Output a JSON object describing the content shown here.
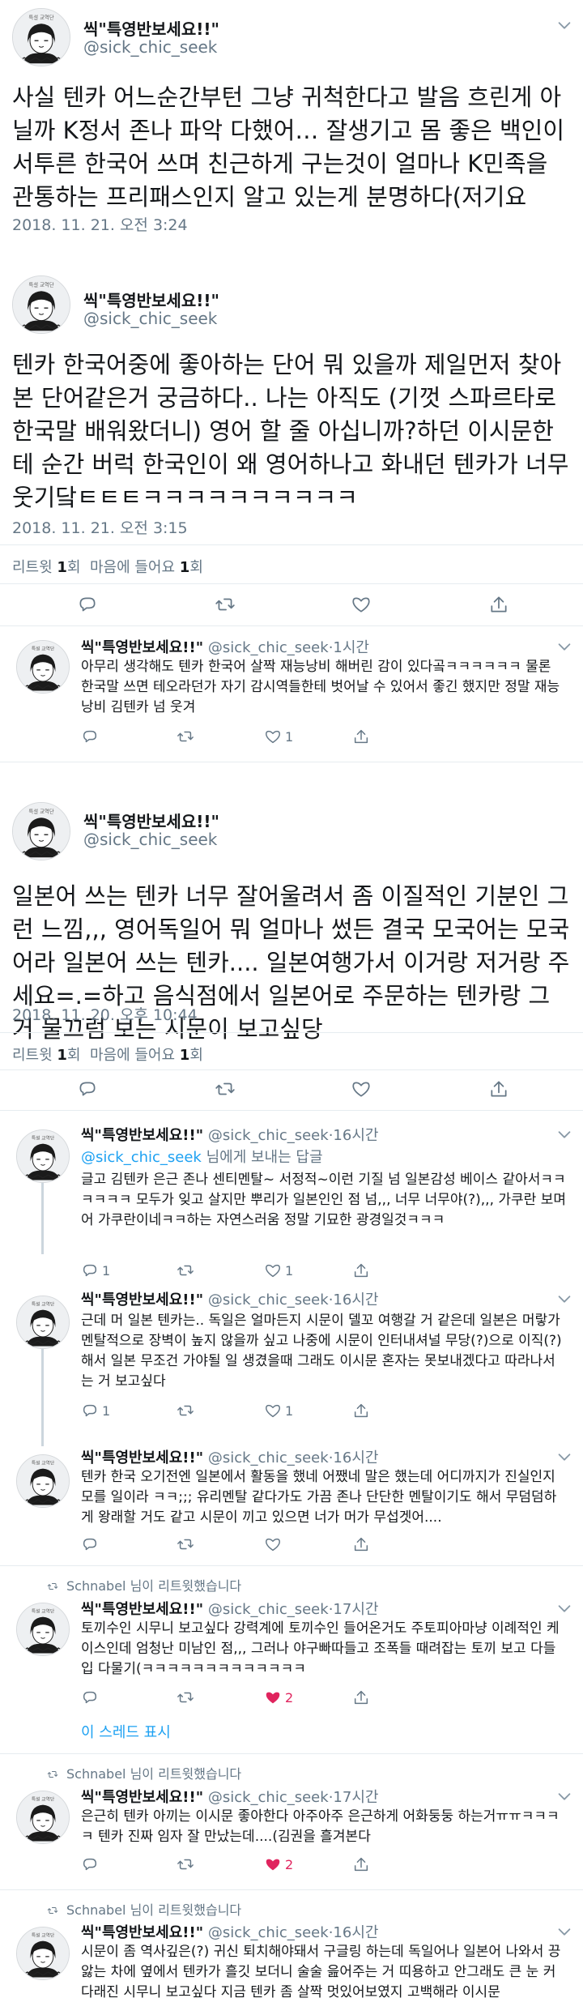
{
  "author": {
    "name": "씩\"특영반보세요!!\"",
    "handle": "@sick_chic_seek"
  },
  "tweets": [
    {
      "body": "사실 텐카 어느순간부턴 그냥 귀척한다고 발음 흐린게 아닐까 K정서 존나 파악 다했어… 잘생기고 몸 좋은 백인이 서투른 한국어 쓰며 친근하게 구는것이 얼마나 K민족을 관통하는 프리패스인지 알고 있는게 분명하다(저기요",
      "time": "2018. 11. 21. 오전 3:24"
    },
    {
      "body": "텐카 한국어중에 좋아하는 단어 뭐 있을까 제일먼저 찾아본 단어같은거 궁금하다.. 나는 아직도 (기껏 스파르타로 한국말 배워왔더니) 영어 할 줄 아십니까?하던 이시문한테 순간 버럭 한국인이 왜 영어하나고 화내던 텐카가 너무 웃기닼ㅌㅌㅌㅋㅋㅋㅋㅋㅋㅋㅋㅋㅋ",
      "time": "2018. 11. 21. 오전 3:15",
      "stats": {
        "retweets": "1",
        "retweets_label": "리트윗",
        "likes": "1",
        "likes_label": "마음에 들어요"
      }
    },
    {
      "body": "일본어 쓰는 텐카 너무 잘어울려서 좀 이질적인 기분인 그런 느낌,,, 영어독일어 뭐 얼마나 썼든 결국 모국어는 모국어라 일본어 쓰는 텐카.... 일본여행가서 이거랑 저거랑 주세요=.=하고 음식점에서 일본어로 주문하는 텐카랑 그거 물끄럼 보는 시문이 보고싶당",
      "time": "2018. 11. 20. 오후 10:44",
      "stats": {
        "retweets": "1",
        "retweets_label": "리트윗",
        "likes": "1",
        "likes_label": "마음에 들어요"
      }
    }
  ],
  "replies": [
    {
      "meta": "1시간",
      "body": "아무리 생각해도 텐카 한국어 살짝 재능낭비 해버린 감이 있다곸ㅋㅋㅋㅋㅋㅋ 물론 한국말 쓰면 테오라던가 자기 감시역들한테 벗어날 수 있어서 좋긴 했지만 정말 재능낭비 김텐카 넘 웃겨",
      "replies": "",
      "retweets": "",
      "likes": "1"
    },
    {
      "meta": "16시간",
      "replying_prefix": "",
      "replying_mention": "@sick_chic_seek",
      "replying_suffix": " 님에게 보내는 답글",
      "body": "글고 김텐카 은근 존나 센티멘탈~ 서정적~이런 기질 넘 일본감성 베이스 같아서ㅋㅋㅋㅋㅋㅋ 모두가 잊고 살지만 뿌리가 일본인인 점 넘,,, 너무 너무야(?),,, 가쿠란 보며 어 가쿠란이네ㅋㅋ하는 자연스러움 정말 기묘한 광경일것ㅋㅋㅋ",
      "replies": "1",
      "retweets": "",
      "likes": "1"
    },
    {
      "meta": "16시간",
      "body": "근데 머 일본 텐카는.. 독일은 얼마든지 시문이 델꼬 여행갈 거 같은데 일본은 머랗가 멘탈적으로 장벽이 높지 않을까 싶고 나중에 시문이 인터내셔널 무당(?)으로 이직(?)해서 일본 무조건 가야될 일 생겼을때 그래도 이시문 혼자는 못보내겠다고 따라나서는 거 보고싶다",
      "replies": "1",
      "retweets": "",
      "likes": "1"
    },
    {
      "meta": "16시간",
      "body": "텐카 한국 오기전엔 일본에서 활동을 했네 어쨌네 말은 했는데 어디까지가 진실인지 모를 일이라 ㅋㅋ;;; 유리멘탈 같다가도 가끔 존나 단단한 멘탈이기도 해서 무덤덤하게 왕래할 거도 같고 시문이 끼고 있으면 너가 머가 무섭겟어....",
      "replies": "",
      "retweets": "",
      "likes": ""
    },
    {
      "rt_note": "Schnabel 님이 리트윗했습니다",
      "meta": "17시간",
      "body": "토끼수인 시무니 보고싶다 강력계에 토끼수인 들어온거도 주토피아마냥 이례적인 케이스인데 엄청난 미남인 점,,, 그러나 야구빠따들고 조폭들 때려잡는 토끼 보고 다들 입 다물기(ㅋㅋㅋㅋㅋㅋㅋㅋㅋㅋㅋㅋㅋ",
      "replies": "",
      "retweets": "",
      "likes": "2",
      "show_thread": "이 스레드 표시"
    },
    {
      "rt_note": "Schnabel 님이 리트윗했습니다",
      "meta": "17시간",
      "body": "은근히 텐카 아끼는 이시문 좋아한다 아주아주 은근하게 어화둥둥 하는거ㅠㅠㅋㅋㅋㅋ 텐카 진짜 임자 잘 만났는데....(김권을 흘겨본다",
      "replies": "",
      "retweets": "",
      "likes": "2"
    },
    {
      "rt_note": "Schnabel 님이 리트윗했습니다",
      "meta": "16시간",
      "body": "시문이 좀 역사깊은(?) 귀신 퇴치해야돼서 구글링 하는데 독일어나 일본어 나와서 끙 앓는 차에 옆에서 텐카가 흘깃 보더니 술술 읊어주는 거 띠용하고 안그래도 큰 눈 커다래진 시무니 보고싶다 지금 텐카 좀 살짝 멋있어보였지 고백해라 이시문",
      "replies": "",
      "retweets": "",
      "likes": ""
    }
  ],
  "icons": [
    "avatar-icon",
    "chevron-down-icon",
    "reply-icon",
    "retweet-icon",
    "like-icon",
    "share-icon"
  ],
  "colors": {
    "accent": "#1da1f2",
    "like": "#e0245e",
    "secondary": "#657786",
    "divider": "#e6ecf0"
  }
}
